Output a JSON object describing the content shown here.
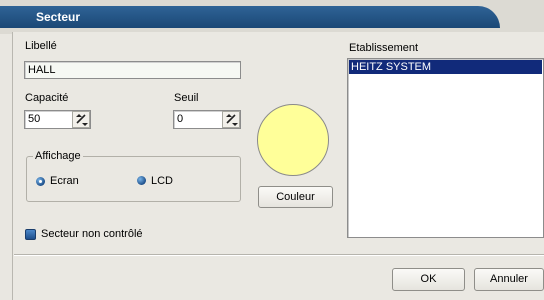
{
  "window": {
    "title": "Secteur"
  },
  "form": {
    "libelle_label": "Libellé",
    "libelle_value": "HALL",
    "capacite_label": "Capacité",
    "capacite_value": "50",
    "seuil_label": "Seuil",
    "seuil_value": "0",
    "affichage": {
      "title": "Affichage",
      "options": [
        {
          "label": "Ecran",
          "selected": true
        },
        {
          "label": "LCD",
          "selected": false
        }
      ]
    },
    "color_preview": "#ffff99",
    "couleur_button": "Couleur",
    "checkbox_label": "Secteur non contrôlé"
  },
  "etablissement": {
    "label": "Etablissement",
    "items": [
      "HEITZ SYSTEM"
    ],
    "selected_index": 0
  },
  "buttons": {
    "ok": "OK",
    "cancel": "Annuler"
  }
}
